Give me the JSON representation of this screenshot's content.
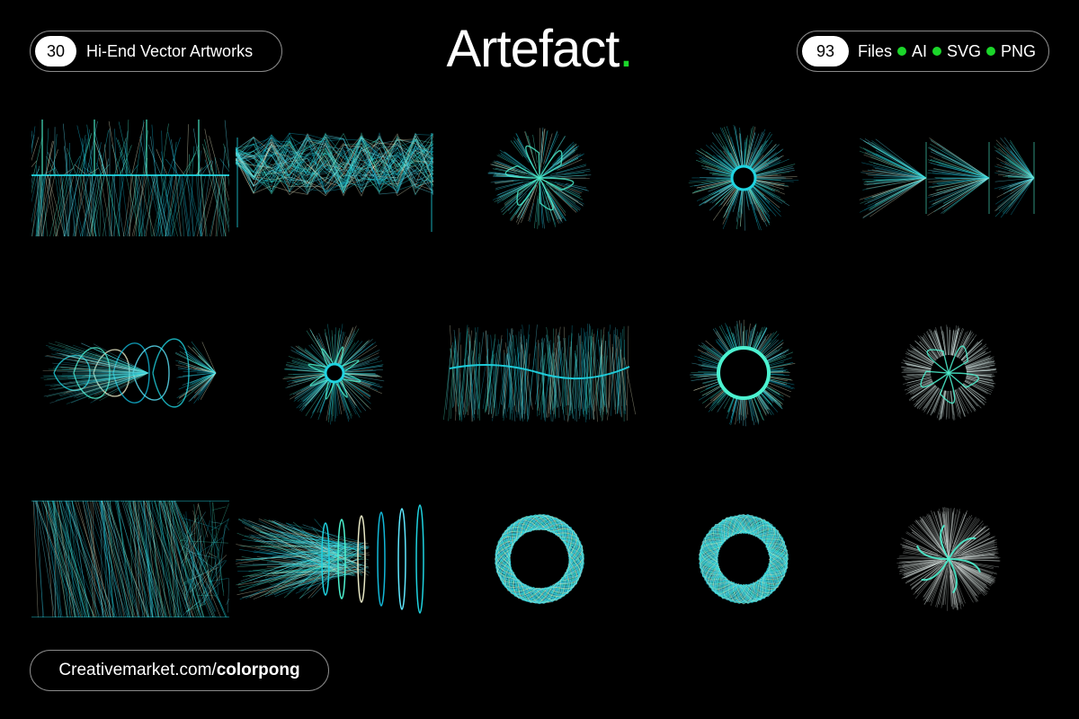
{
  "header": {
    "left_badge": {
      "count": "30",
      "label": "Hi-End Vector Artworks"
    },
    "title": "Artefact",
    "title_dot": ".",
    "right_badge": {
      "count": "93",
      "files_label": "Files",
      "formats": [
        "AI",
        "SVG",
        "PNG"
      ]
    }
  },
  "footer": {
    "url_prefix": "Creativemarket.com/",
    "url_handle": "colorpong"
  },
  "colors": {
    "background": "#000000",
    "accent_green": "#1bd62a",
    "art_cyan": "#1fd3e0",
    "art_aqua": "#4cf2d0",
    "art_cream": "#e9e9c6"
  },
  "artworks": [
    {
      "name": "artwork-1",
      "style": "vertical-grid"
    },
    {
      "name": "artwork-2",
      "style": "zigzag-band"
    },
    {
      "name": "artwork-3",
      "style": "loop-circle"
    },
    {
      "name": "artwork-4",
      "style": "ring-burst"
    },
    {
      "name": "artwork-5",
      "style": "arrow-fan"
    },
    {
      "name": "artwork-6",
      "style": "loop-fan"
    },
    {
      "name": "artwork-7",
      "style": "petal-burst"
    },
    {
      "name": "artwork-8",
      "style": "vertical-band"
    },
    {
      "name": "artwork-9",
      "style": "open-ring"
    },
    {
      "name": "artwork-10",
      "style": "white-loop-circle"
    },
    {
      "name": "artwork-11",
      "style": "diagonal-panels"
    },
    {
      "name": "artwork-12",
      "style": "ring-stack"
    },
    {
      "name": "artwork-13",
      "style": "twisted-torus"
    },
    {
      "name": "artwork-14",
      "style": "twisted-torus-alt"
    },
    {
      "name": "artwork-15",
      "style": "white-petal-circle"
    }
  ]
}
